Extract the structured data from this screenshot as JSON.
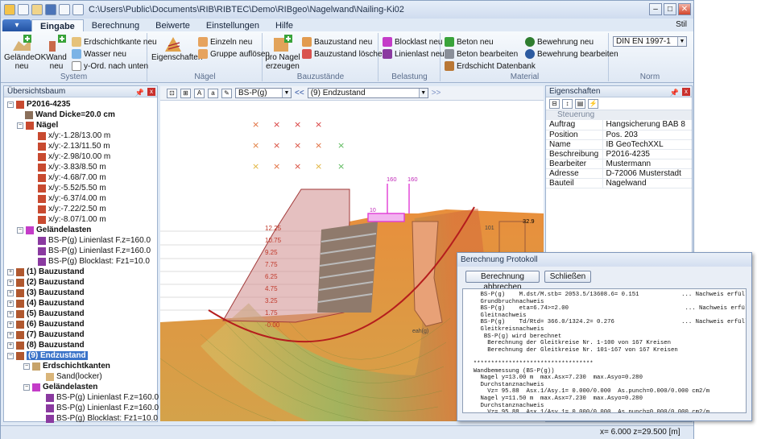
{
  "title": "C:\\Users\\Public\\Documents\\RIB\\RIBTEC\\Demo\\RIBgeo\\Nagelwand\\Nailing-Ki02",
  "tabs": [
    "Eingabe",
    "Berechnung",
    "Beiwerte",
    "Einstellungen",
    "Hilfe"
  ],
  "stil": "Stil",
  "ribbon": {
    "system": {
      "label": "System",
      "b1": "GeländeOK neu",
      "b2": "Wand neu",
      "s1": "Erdschichtkante neu",
      "s2": "Wasser neu",
      "s3": "y-Ord. nach unten"
    },
    "naegel": {
      "label": "Nägel",
      "b1": "Eigenschaften",
      "s1": "Einzeln neu",
      "s2": "Gruppe auflösen"
    },
    "bau": {
      "label": "Bauzustände",
      "b1": "pro Nagel erzeugen",
      "s1": "Bauzustand neu",
      "s2": "Bauzustand löschen"
    },
    "bel": {
      "label": "Belastung",
      "s1": "Blocklast neu",
      "s2": "Linienlast neu"
    },
    "mat": {
      "label": "Material",
      "s1": "Beton neu",
      "s2": "Beton bearbeiten",
      "s3": "Erdschicht Datenbank",
      "s4": "Bewehrung neu",
      "s5": "Bewehrung bearbeiten"
    },
    "norm": {
      "label": "Norm",
      "value": "DIN EN 1997-1"
    }
  },
  "tree": {
    "title": "Übersichtsbaum",
    "root": "P2016-4235",
    "wand": "Wand Dicke=20.0 cm",
    "naegel": "Nägel",
    "nails": [
      "x/y:-1.28/13.00 m",
      "x/y:-2.13/11.50 m",
      "x/y:-2.98/10.00 m",
      "x/y:-3.83/8.50 m",
      "x/y:-4.68/7.00 m",
      "x/y:-5.52/5.50 m",
      "x/y:-6.37/4.00 m",
      "x/y:-7.22/2.50 m",
      "x/y:-8.07/1.00 m"
    ],
    "gel": "Geländelasten",
    "loads": [
      "BS-P(g) Linienlast F.z=160.0",
      "BS-P(g) Linienlast F.z=160.0",
      "BS-P(g) Blocklast: Fz1=10.0"
    ],
    "stages": [
      "(1) Bauzustand",
      "(2) Bauzustand",
      "(3) Bauzustand",
      "(4) Bauzustand",
      "(5) Bauzustand",
      "(6) Bauzustand",
      "(7) Bauzustand",
      "(8) Bauzustand"
    ],
    "end": "(9) Endzustand",
    "ek": "Erdschichtkanten",
    "sand": "Sand(locker)",
    "gel2": "Geländelasten",
    "loads2": [
      "BS-P(g) Linienlast F.z=160.0",
      "BS-P(g) Linienlast F.z=160.0",
      "BS-P(g) Blocklast: Fz1=10.0"
    ]
  },
  "view": {
    "combo1": "BS-P(g)",
    "prev": "<<",
    "combo2": "(9) Endzustand",
    "next": ">>",
    "labels": [
      "12.25",
      "10.75",
      "9.25",
      "7.75",
      "6.25",
      "4.75",
      "3.25",
      "1.75",
      "-0.00"
    ],
    "load1": "160",
    "load2": "160",
    "block": "10",
    "right": "32.9",
    "lbl101": "101",
    "eah": "eah(g)"
  },
  "props": {
    "title": "Eigenschaften",
    "section": "Steuerung",
    "rows": [
      [
        "Auftrag",
        "Hangsicherung BAB 8"
      ],
      [
        "Position",
        "Pos. 203"
      ],
      [
        "Name",
        "IB GeoTechXXL"
      ],
      [
        "Beschreibung",
        "P2016-4235"
      ],
      [
        "Bearbeiter",
        "Mustermann"
      ],
      [
        "Adresse",
        "D-72006 Musterstadt"
      ],
      [
        "Bauteil",
        "Nagelwand"
      ]
    ]
  },
  "dialog": {
    "title": "Berechnung Protokoll",
    "abort": "Berechnung abbrechen",
    "close": "Schließen",
    "log": [
      "    BS-P(g)    M.dst/M.stb= 2053.5/13608.6= 0.151            ... Nachweis erfüllt",
      "    Grundbruchnachweis",
      "    BS-P(g)    eta=6.74>=2.00                                 ... Nachweis erfüllt",
      "    Gleitnachweis",
      "    BS-P(g)    Td/Rtd= 366.0/1324.2= 0.276                   ... Nachweis erfüllt",
      "    Gleitkreisnachweis",
      "     BS-P(g) wird berechnet",
      "      Berechnung der Gleitkreise Nr. 1-100 von 167 Kreisen",
      "      Berechnung der Gleitkreise Nr. 101-167 von 167 Kreisen",
      "",
      "  **********************************",
      "  Wandbemessung (BS-P(g))",
      "    Nagel y=13.00 m  max.Asx=7.230  max.Asyo=0.280",
      "    Durchstanznachweis",
      "      Vz= 95.88  Asx.1/Asy.1= 0.000/0.000  As.punch=0.000/0.000 cm2/m",
      "    Nagel y=11.50 m  max.Asx=7.230  max.Asyo=0.280",
      "    Durchstanznachweis",
      "      Vz= 95.88  Asx.1/Asy.1= 0.000/0.000  As.punch=0.000/0.000 cm2/m",
      "    Nagel y=10.00 m  max.Asx=7.230  max.Asyo=0.280"
    ]
  },
  "status": {
    "coords": "x= 6.000   z=29.500 [m]"
  }
}
